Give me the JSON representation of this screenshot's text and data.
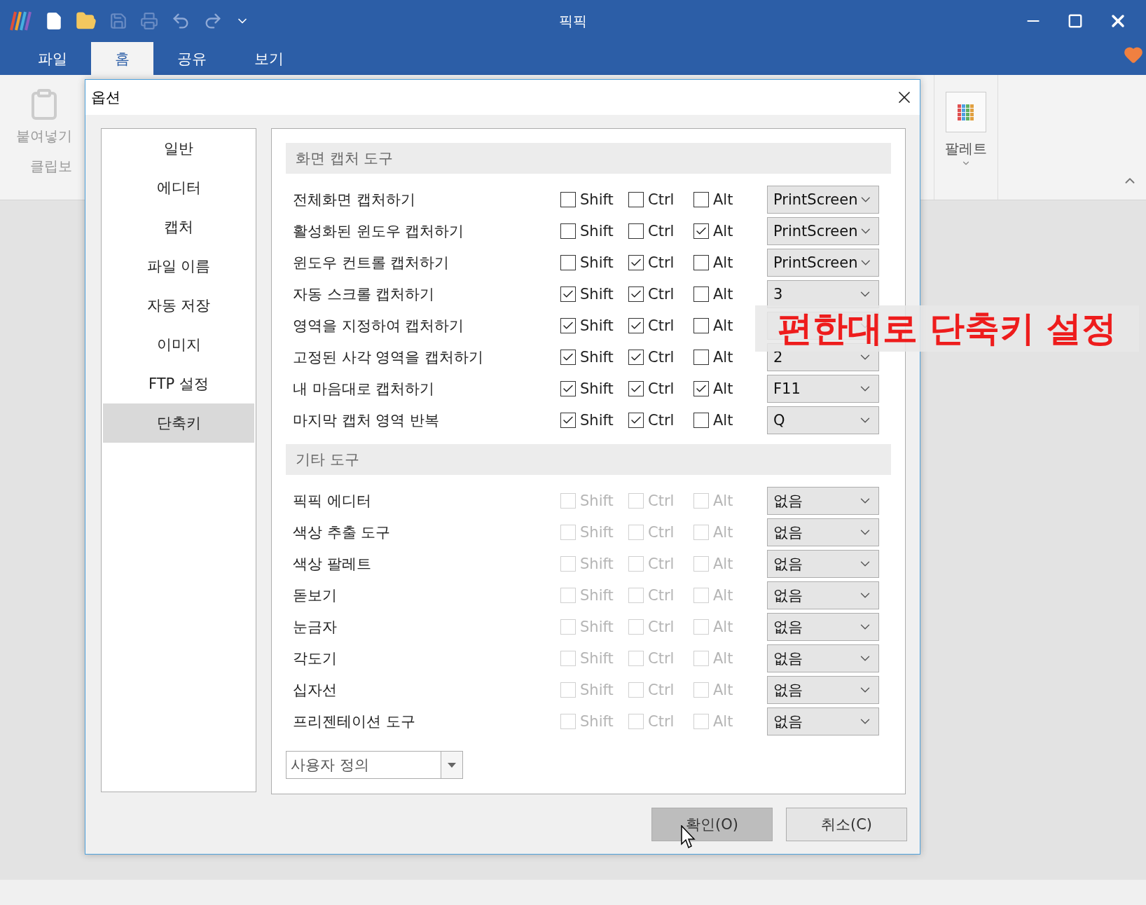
{
  "app": {
    "title": "픽픽",
    "menu_tabs": [
      {
        "label": "파일",
        "selected": false
      },
      {
        "label": "홈",
        "selected": true
      },
      {
        "label": "공유",
        "selected": false
      },
      {
        "label": "보기",
        "selected": false
      }
    ],
    "ribbon": {
      "paste_label": "붙여넣기",
      "group_label": "클립보",
      "palette_label": "팔레트"
    }
  },
  "dialog": {
    "title": "옵션",
    "nav": [
      {
        "label": "일반",
        "selected": false
      },
      {
        "label": "에디터",
        "selected": false
      },
      {
        "label": "캡처",
        "selected": false
      },
      {
        "label": "파일 이름",
        "selected": false
      },
      {
        "label": "자동 저장",
        "selected": false
      },
      {
        "label": "이미지",
        "selected": false
      },
      {
        "label": "FTP 설정",
        "selected": false
      },
      {
        "label": "단축키",
        "selected": true
      }
    ],
    "sections": [
      {
        "title": "화면 캡처 도구",
        "rows": [
          {
            "label": "전체화면 캡처하기",
            "disabled": false,
            "modifiers": [
              {
                "label": "Shift",
                "checked": false
              },
              {
                "label": "Ctrl",
                "checked": false
              },
              {
                "label": "Alt",
                "checked": false
              }
            ],
            "key": "PrintScreen"
          },
          {
            "label": "활성화된 윈도우 캡처하기",
            "disabled": false,
            "modifiers": [
              {
                "label": "Shift",
                "checked": false
              },
              {
                "label": "Ctrl",
                "checked": false
              },
              {
                "label": "Alt",
                "checked": true
              }
            ],
            "key": "PrintScreen"
          },
          {
            "label": "윈도우 컨트롤 캡처하기",
            "disabled": false,
            "modifiers": [
              {
                "label": "Shift",
                "checked": false
              },
              {
                "label": "Ctrl",
                "checked": true
              },
              {
                "label": "Alt",
                "checked": false
              }
            ],
            "key": "PrintScreen"
          },
          {
            "label": "자동 스크롤 캡처하기",
            "disabled": false,
            "modifiers": [
              {
                "label": "Shift",
                "checked": true
              },
              {
                "label": "Ctrl",
                "checked": true
              },
              {
                "label": "Alt",
                "checked": false
              }
            ],
            "key": "3"
          },
          {
            "label": "영역을 지정하여 캡처하기",
            "disabled": false,
            "modifiers": [
              {
                "label": "Shift",
                "checked": true
              },
              {
                "label": "Ctrl",
                "checked": true
              },
              {
                "label": "Alt",
                "checked": false
              }
            ]
          },
          {
            "label": "고정된 사각 영역을 캡처하기",
            "disabled": false,
            "modifiers": [
              {
                "label": "Shift",
                "checked": true
              },
              {
                "label": "Ctrl",
                "checked": true
              },
              {
                "label": "Alt",
                "checked": false
              }
            ],
            "key": "2"
          },
          {
            "label": "내 마음대로 캡처하기",
            "disabled": false,
            "modifiers": [
              {
                "label": "Shift",
                "checked": true
              },
              {
                "label": "Ctrl",
                "checked": true
              },
              {
                "label": "Alt",
                "checked": true
              }
            ],
            "key": "F11"
          },
          {
            "label": "마지막 캡처 영역 반복",
            "disabled": false,
            "modifiers": [
              {
                "label": "Shift",
                "checked": true
              },
              {
                "label": "Ctrl",
                "checked": true
              },
              {
                "label": "Alt",
                "checked": false
              }
            ],
            "key": "Q"
          }
        ]
      },
      {
        "title": "기타 도구",
        "rows": [
          {
            "label": "픽픽 에디터",
            "disabled": true,
            "modifiers": [
              {
                "label": "Shift",
                "checked": false
              },
              {
                "label": "Ctrl",
                "checked": false
              },
              {
                "label": "Alt",
                "checked": false
              }
            ],
            "key": "없음"
          },
          {
            "label": "색상 추출 도구",
            "disabled": true,
            "modifiers": [
              {
                "label": "Shift",
                "checked": false
              },
              {
                "label": "Ctrl",
                "checked": false
              },
              {
                "label": "Alt",
                "checked": false
              }
            ],
            "key": "없음"
          },
          {
            "label": "색상 팔레트",
            "disabled": true,
            "modifiers": [
              {
                "label": "Shift",
                "checked": false
              },
              {
                "label": "Ctrl",
                "checked": false
              },
              {
                "label": "Alt",
                "checked": false
              }
            ],
            "key": "없음"
          },
          {
            "label": "돋보기",
            "disabled": true,
            "modifiers": [
              {
                "label": "Shift",
                "checked": false
              },
              {
                "label": "Ctrl",
                "checked": false
              },
              {
                "label": "Alt",
                "checked": false
              }
            ],
            "key": "없음"
          },
          {
            "label": "눈금자",
            "disabled": true,
            "modifiers": [
              {
                "label": "Shift",
                "checked": false
              },
              {
                "label": "Ctrl",
                "checked": false
              },
              {
                "label": "Alt",
                "checked": false
              }
            ],
            "key": "없음"
          },
          {
            "label": "각도기",
            "disabled": true,
            "modifiers": [
              {
                "label": "Shift",
                "checked": false
              },
              {
                "label": "Ctrl",
                "checked": false
              },
              {
                "label": "Alt",
                "checked": false
              }
            ],
            "key": "없음"
          },
          {
            "label": "십자선",
            "disabled": true,
            "modifiers": [
              {
                "label": "Shift",
                "checked": false
              },
              {
                "label": "Ctrl",
                "checked": false
              },
              {
                "label": "Alt",
                "checked": false
              }
            ],
            "key": "없음"
          },
          {
            "label": "프리젠테이션 도구",
            "disabled": true,
            "modifiers": [
              {
                "label": "Shift",
                "checked": false
              },
              {
                "label": "Ctrl",
                "checked": false
              },
              {
                "label": "Alt",
                "checked": false
              }
            ],
            "key": "없음"
          }
        ]
      }
    ],
    "preset": "사용자 정의",
    "buttons": [
      {
        "label": "확인(O)",
        "hovered": true
      },
      {
        "label": "취소(C)",
        "hovered": false
      }
    ]
  },
  "overlay_caption": "편한대로 단축키 설정"
}
